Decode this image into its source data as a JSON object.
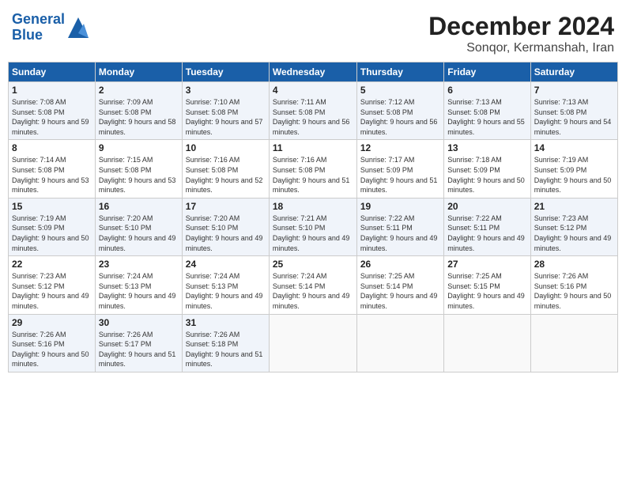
{
  "header": {
    "logo_line1": "General",
    "logo_line2": "Blue",
    "month": "December 2024",
    "location": "Sonqor, Kermanshah, Iran"
  },
  "weekdays": [
    "Sunday",
    "Monday",
    "Tuesday",
    "Wednesday",
    "Thursday",
    "Friday",
    "Saturday"
  ],
  "weeks": [
    [
      {
        "day": "1",
        "sunrise": "Sunrise: 7:08 AM",
        "sunset": "Sunset: 5:08 PM",
        "daylight": "Daylight: 9 hours and 59 minutes."
      },
      {
        "day": "2",
        "sunrise": "Sunrise: 7:09 AM",
        "sunset": "Sunset: 5:08 PM",
        "daylight": "Daylight: 9 hours and 58 minutes."
      },
      {
        "day": "3",
        "sunrise": "Sunrise: 7:10 AM",
        "sunset": "Sunset: 5:08 PM",
        "daylight": "Daylight: 9 hours and 57 minutes."
      },
      {
        "day": "4",
        "sunrise": "Sunrise: 7:11 AM",
        "sunset": "Sunset: 5:08 PM",
        "daylight": "Daylight: 9 hours and 56 minutes."
      },
      {
        "day": "5",
        "sunrise": "Sunrise: 7:12 AM",
        "sunset": "Sunset: 5:08 PM",
        "daylight": "Daylight: 9 hours and 56 minutes."
      },
      {
        "day": "6",
        "sunrise": "Sunrise: 7:13 AM",
        "sunset": "Sunset: 5:08 PM",
        "daylight": "Daylight: 9 hours and 55 minutes."
      },
      {
        "day": "7",
        "sunrise": "Sunrise: 7:13 AM",
        "sunset": "Sunset: 5:08 PM",
        "daylight": "Daylight: 9 hours and 54 minutes."
      }
    ],
    [
      {
        "day": "8",
        "sunrise": "Sunrise: 7:14 AM",
        "sunset": "Sunset: 5:08 PM",
        "daylight": "Daylight: 9 hours and 53 minutes."
      },
      {
        "day": "9",
        "sunrise": "Sunrise: 7:15 AM",
        "sunset": "Sunset: 5:08 PM",
        "daylight": "Daylight: 9 hours and 53 minutes."
      },
      {
        "day": "10",
        "sunrise": "Sunrise: 7:16 AM",
        "sunset": "Sunset: 5:08 PM",
        "daylight": "Daylight: 9 hours and 52 minutes."
      },
      {
        "day": "11",
        "sunrise": "Sunrise: 7:16 AM",
        "sunset": "Sunset: 5:08 PM",
        "daylight": "Daylight: 9 hours and 51 minutes."
      },
      {
        "day": "12",
        "sunrise": "Sunrise: 7:17 AM",
        "sunset": "Sunset: 5:09 PM",
        "daylight": "Daylight: 9 hours and 51 minutes."
      },
      {
        "day": "13",
        "sunrise": "Sunrise: 7:18 AM",
        "sunset": "Sunset: 5:09 PM",
        "daylight": "Daylight: 9 hours and 50 minutes."
      },
      {
        "day": "14",
        "sunrise": "Sunrise: 7:19 AM",
        "sunset": "Sunset: 5:09 PM",
        "daylight": "Daylight: 9 hours and 50 minutes."
      }
    ],
    [
      {
        "day": "15",
        "sunrise": "Sunrise: 7:19 AM",
        "sunset": "Sunset: 5:09 PM",
        "daylight": "Daylight: 9 hours and 50 minutes."
      },
      {
        "day": "16",
        "sunrise": "Sunrise: 7:20 AM",
        "sunset": "Sunset: 5:10 PM",
        "daylight": "Daylight: 9 hours and 49 minutes."
      },
      {
        "day": "17",
        "sunrise": "Sunrise: 7:20 AM",
        "sunset": "Sunset: 5:10 PM",
        "daylight": "Daylight: 9 hours and 49 minutes."
      },
      {
        "day": "18",
        "sunrise": "Sunrise: 7:21 AM",
        "sunset": "Sunset: 5:10 PM",
        "daylight": "Daylight: 9 hours and 49 minutes."
      },
      {
        "day": "19",
        "sunrise": "Sunrise: 7:22 AM",
        "sunset": "Sunset: 5:11 PM",
        "daylight": "Daylight: 9 hours and 49 minutes."
      },
      {
        "day": "20",
        "sunrise": "Sunrise: 7:22 AM",
        "sunset": "Sunset: 5:11 PM",
        "daylight": "Daylight: 9 hours and 49 minutes."
      },
      {
        "day": "21",
        "sunrise": "Sunrise: 7:23 AM",
        "sunset": "Sunset: 5:12 PM",
        "daylight": "Daylight: 9 hours and 49 minutes."
      }
    ],
    [
      {
        "day": "22",
        "sunrise": "Sunrise: 7:23 AM",
        "sunset": "Sunset: 5:12 PM",
        "daylight": "Daylight: 9 hours and 49 minutes."
      },
      {
        "day": "23",
        "sunrise": "Sunrise: 7:24 AM",
        "sunset": "Sunset: 5:13 PM",
        "daylight": "Daylight: 9 hours and 49 minutes."
      },
      {
        "day": "24",
        "sunrise": "Sunrise: 7:24 AM",
        "sunset": "Sunset: 5:13 PM",
        "daylight": "Daylight: 9 hours and 49 minutes."
      },
      {
        "day": "25",
        "sunrise": "Sunrise: 7:24 AM",
        "sunset": "Sunset: 5:14 PM",
        "daylight": "Daylight: 9 hours and 49 minutes."
      },
      {
        "day": "26",
        "sunrise": "Sunrise: 7:25 AM",
        "sunset": "Sunset: 5:14 PM",
        "daylight": "Daylight: 9 hours and 49 minutes."
      },
      {
        "day": "27",
        "sunrise": "Sunrise: 7:25 AM",
        "sunset": "Sunset: 5:15 PM",
        "daylight": "Daylight: 9 hours and 49 minutes."
      },
      {
        "day": "28",
        "sunrise": "Sunrise: 7:26 AM",
        "sunset": "Sunset: 5:16 PM",
        "daylight": "Daylight: 9 hours and 50 minutes."
      }
    ],
    [
      {
        "day": "29",
        "sunrise": "Sunrise: 7:26 AM",
        "sunset": "Sunset: 5:16 PM",
        "daylight": "Daylight: 9 hours and 50 minutes."
      },
      {
        "day": "30",
        "sunrise": "Sunrise: 7:26 AM",
        "sunset": "Sunset: 5:17 PM",
        "daylight": "Daylight: 9 hours and 51 minutes."
      },
      {
        "day": "31",
        "sunrise": "Sunrise: 7:26 AM",
        "sunset": "Sunset: 5:18 PM",
        "daylight": "Daylight: 9 hours and 51 minutes."
      },
      null,
      null,
      null,
      null
    ]
  ]
}
